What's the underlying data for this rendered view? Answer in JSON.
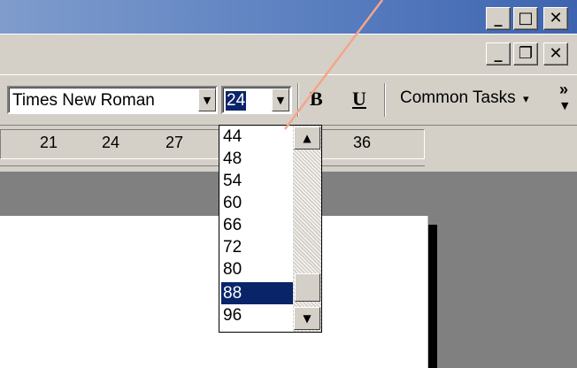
{
  "window_controls": {
    "minimize": "_",
    "maximize": "□",
    "close": "✕"
  },
  "document_controls": {
    "minimize": "_",
    "restore": "❐",
    "close": "✕"
  },
  "toolbar": {
    "font_name": "Times New Roman",
    "font_size": "24",
    "bold_label": "B",
    "underline_label": "U",
    "common_tasks_label": "Common Tasks",
    "common_tasks_arrow": "▾",
    "overflow": "»"
  },
  "ruler": {
    "labels": [
      "21",
      "24",
      "27",
      "36"
    ]
  },
  "font_size_list": {
    "items": [
      "44",
      "48",
      "54",
      "60",
      "66",
      "72",
      "80",
      "88",
      "96"
    ],
    "selected": "88"
  },
  "colors": {
    "accent_line": "#f4a58a",
    "selection": "#0a246a",
    "chrome": "#d4d0c8"
  }
}
